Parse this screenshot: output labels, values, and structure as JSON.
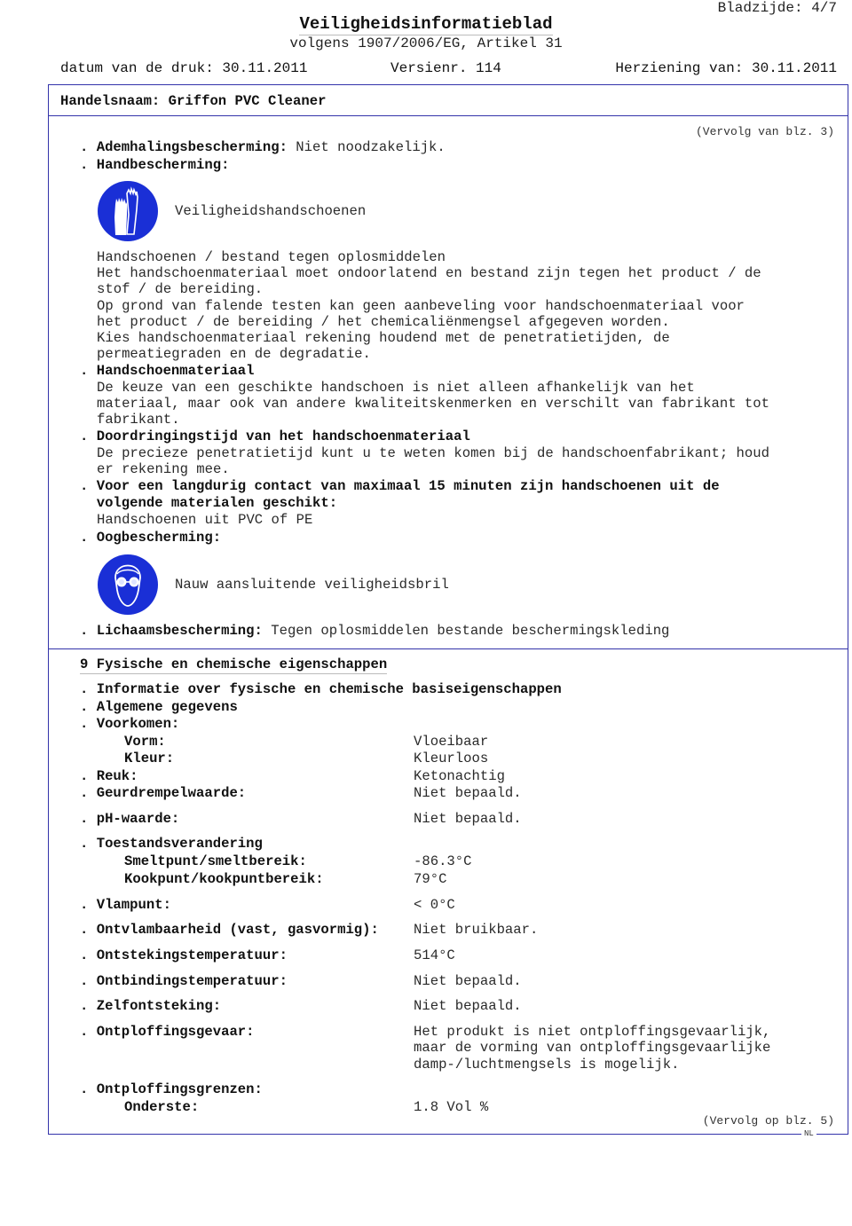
{
  "header": {
    "page_number": "Bladzijde: 4/7",
    "title": "Veiligheidsinformatieblad",
    "subtitle": "volgens 1907/2006/EG, Artikel 31",
    "print_date": "datum van de druk: 30.11.2011",
    "version": "Versienr. 114",
    "revision": "Herziening van: 30.11.2011"
  },
  "trade_name": "Handelsnaam: Griffon PVC Cleaner",
  "continued_from": "(Vervolg van blz. 3)",
  "continued_to": "(Vervolg op blz. 5)",
  "language_tag": "NL",
  "protection": {
    "respiratory_label": ". Ademhalingsbescherming:",
    "respiratory_value": " Niet noodzakelijk.",
    "hand_label": ". Handbescherming:",
    "hand_icon": "gloves-icon",
    "hand_icon_caption": "Veiligheidshandschoenen",
    "hand_text": [
      "Handschoenen / bestand tegen oplosmiddelen",
      "Het handschoenmateriaal moet ondoorlatend en bestand zijn tegen het product / de",
      "stof / de bereiding.",
      "Op grond van falende testen kan geen aanbeveling voor handschoenmateriaal voor",
      "het product / de bereiding / het chemicaliënmengsel afgegeven worden.",
      "Kies handschoenmateriaal rekening houdend met de penetratietijden, de",
      "permeatiegraden en de degradatie."
    ],
    "glove_material_label": ". Handschoenmateriaal",
    "glove_material_text": [
      "De keuze van een geschikte handschoen is niet alleen afhankelijk van het",
      "materiaal, maar ook van andere kwaliteitskenmerken en verschilt van fabrikant tot",
      "fabrikant."
    ],
    "penetration_label": ". Doordringingstijd van het handschoenmateriaal",
    "penetration_text": [
      "De precieze penetratietijd kunt u te weten komen bij de handschoenfabrikant; houd",
      "er rekening mee."
    ],
    "long_contact_label": [
      ". Voor een langdurig contact van maximaal 15 minuten zijn handschoenen uit de",
      "  volgende materialen geschikt:"
    ],
    "long_contact_value": "Handschoenen uit PVC of PE",
    "eye_label": ". Oogbescherming:",
    "eye_icon": "goggles-icon",
    "eye_icon_caption": "Nauw aansluitende veiligheidsbril",
    "body_label": ". Lichaamsbescherming:",
    "body_value": " Tegen oplosmiddelen bestande beschermingskleding"
  },
  "section9": {
    "title": "9 Fysische en chemische eigenschappen",
    "intro_lines": [
      ". Informatie over fysische en chemische basiseigenschappen",
      ". Algemene gegevens",
      ". Voorkomen:"
    ],
    "properties": [
      {
        "label": "Vorm:",
        "value": "Vloeibaar"
      },
      {
        "label": "Kleur:",
        "value": "Kleurloos"
      },
      {
        "label": ". Reuk:",
        "value": "Ketonachtig"
      },
      {
        "label": ". Geurdrempelwaarde:",
        "value": "Niet bepaald."
      },
      {
        "label": ". pH-waarde:",
        "value": "Niet bepaald."
      },
      {
        "label": ". Toestandsverandering",
        "value": ""
      },
      {
        "label": "Smeltpunt/smeltbereik:",
        "value": "-86.3°C"
      },
      {
        "label": "Kookpunt/kookpuntbereik:",
        "value": "79°C"
      },
      {
        "label": ". Vlampunt:",
        "value": "< 0°C"
      },
      {
        "label": ". Ontvlambaarheid (vast, gasvormig):",
        "value": "Niet bruikbaar."
      },
      {
        "label": ". Ontstekingstemperatuur:",
        "value": "514°C"
      },
      {
        "label": ". Ontbindingstemperatuur:",
        "value": "Niet bepaald."
      },
      {
        "label": ". Zelfontsteking:",
        "value": "Niet bepaald."
      },
      {
        "label": ". Ontploffingsgevaar:",
        "value": "Het produkt is niet ontploffingsgevaarlijk,"
      },
      {
        "label": "",
        "value": "maar de vorming van ontploffingsgevaarlijke"
      },
      {
        "label": "",
        "value": "damp-/luchtmengsels is mogelijk."
      },
      {
        "label": ". Ontploffingsgrenzen:",
        "value": ""
      },
      {
        "label": "Onderste:",
        "value": "1.8 Vol %"
      }
    ]
  }
}
